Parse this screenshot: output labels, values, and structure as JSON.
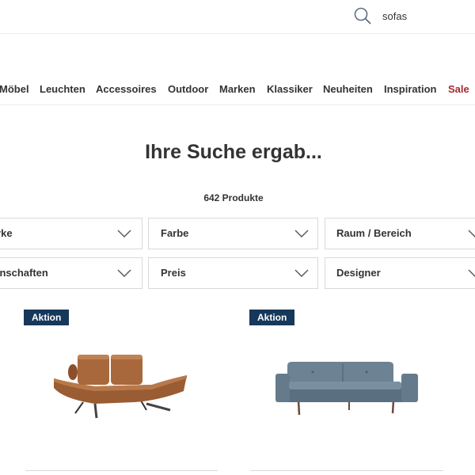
{
  "search": {
    "query": "sofas"
  },
  "nav": {
    "items": [
      "Möbel",
      "Leuchten",
      "Accessoires",
      "Outdoor",
      "Marken",
      "Klassiker",
      "Neuheiten",
      "Inspiration",
      "Sale"
    ]
  },
  "results": {
    "heading": "Ihre Suche ergab...",
    "count": "642 Produkte"
  },
  "filters": {
    "row1": [
      "Marke",
      "Farbe",
      "Raum / Bereich"
    ],
    "row2": [
      "Eigenschaften",
      "Preis",
      "Designer"
    ]
  },
  "products": [
    {
      "badge": "Aktion",
      "image": "daybed-sofa-leather-brown"
    },
    {
      "badge": "Aktion",
      "image": "sofa-grey-blue"
    }
  ],
  "colors": {
    "badge_bg": "#16385a",
    "sale": "#a8282d",
    "border": "#d9d9d9",
    "text": "#333333"
  }
}
